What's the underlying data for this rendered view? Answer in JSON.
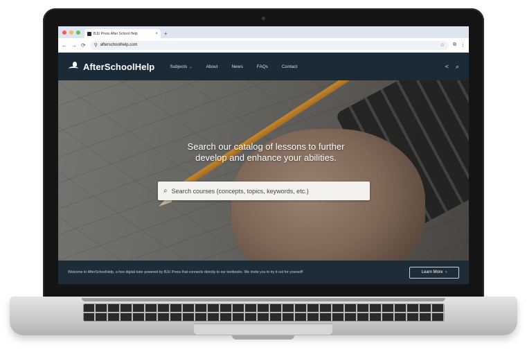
{
  "browser": {
    "tab_title": "BJU Press After School Help",
    "tab_close": "×",
    "new_tab": "+",
    "url": "afterschoolhelp.com",
    "nav_back": "←",
    "nav_forward": "→",
    "nav_reload": "⟳",
    "site_info": "⚲",
    "star": "☆",
    "ext": "⧉",
    "menu": "⋮"
  },
  "site": {
    "logo_text": "AfterSchoolHelp",
    "nav": [
      {
        "label": "Subjects",
        "caret": "⌄"
      },
      {
        "label": "About"
      },
      {
        "label": "News"
      },
      {
        "label": "FAQs"
      },
      {
        "label": "Contact"
      }
    ],
    "share_icon": "<",
    "search_icon": "⌕"
  },
  "hero": {
    "title_line1": "Search our catalog of lessons to further",
    "title_line2": "develop and enhance your abilities.",
    "search_placeholder": "Search courses (concepts, topics, keywords, etc.)",
    "search_glyph": "⌕"
  },
  "banner": {
    "text": "Welcome to AfterSchoolHelp, a free digital tutor powered by BJU Press that connects directly to our textbooks. We invite you to try it out for yourself!",
    "button_label": "Learn More",
    "button_chevron": "›"
  }
}
